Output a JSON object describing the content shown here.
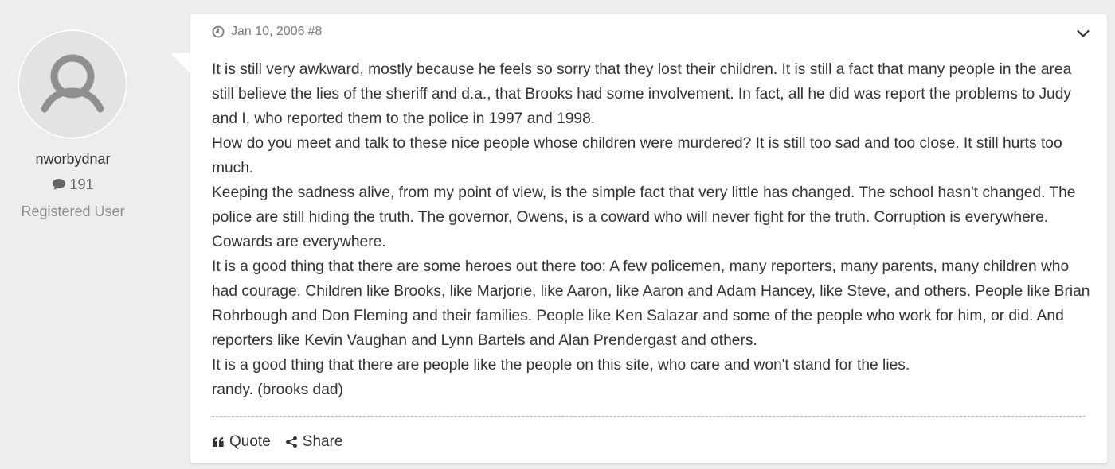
{
  "user": {
    "avatar_icon": "user-silhouette-icon",
    "username": "nworbydnar",
    "post_count": "191",
    "post_count_icon": "speech-bubble-icon",
    "title": "Registered User"
  },
  "post": {
    "date_icon": "clock-icon",
    "date": "Jan 10, 2006",
    "number": "#8",
    "menu_icon": "chevron-down-icon",
    "paragraphs": [
      "It is still very awkward, mostly because he feels so sorry that they lost their children. It is still a fact that many people in the area still believe the lies of the sheriff and d.a., that Brooks had some involvement. In fact, all he did was report the problems to Judy and I, who reported them to the police in 1997 and 1998.",
      "How do you meet and talk to these nice people whose children were murdered? It is still too sad and too close. It still hurts too much.",
      "Keeping the sadness alive, from my point of view, is the simple fact that very little has changed. The school hasn't changed. The police are still hiding the truth. The governor, Owens, is a coward who will never fight for the truth. Corruption is everywhere. Cowards are everywhere.",
      "It is a good thing that there are some heroes out there too: A few policemen, many reporters, many parents, many children who had courage. Children like Brooks, like Marjorie, like Aaron, like Aaron and Adam Hancey, like Steve, and others. People like Brian Rohrbough and Don Fleming and their families. People like Ken Salazar and some of the people who work for him, or did. And reporters like Kevin Vaughan and Lynn Bartels and Alan Prendergast and others.",
      "It is a good thing that there are people like the people on this site, who care and won't stand for the lies.",
      "randy. (brooks dad)"
    ]
  },
  "actions": {
    "quote_label": "Quote",
    "quote_icon": "quote-icon",
    "share_label": "Share",
    "share_icon": "share-icon"
  },
  "colors": {
    "page_background": "#ededed",
    "card_background": "#ffffff",
    "text": "#333333",
    "muted_text": "#7a7a7a"
  }
}
